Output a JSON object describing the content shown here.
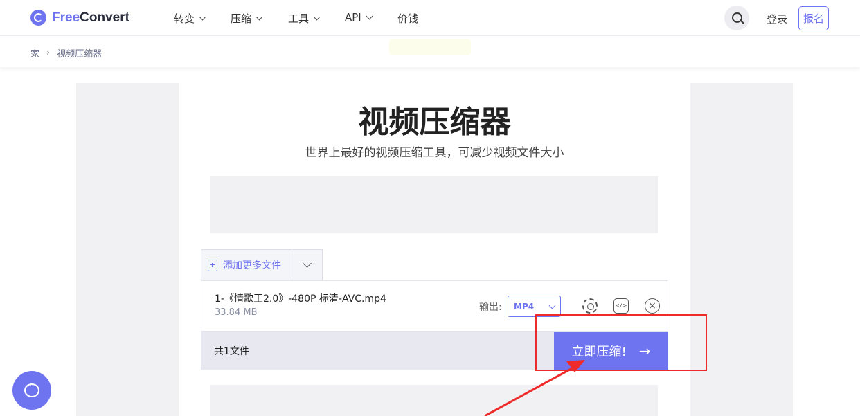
{
  "header": {
    "logo_part1": "Free",
    "logo_part2": "Convert",
    "nav": [
      {
        "label": "转变",
        "has_menu": true
      },
      {
        "label": "压缩",
        "has_menu": true
      },
      {
        "label": "工具",
        "has_menu": true
      },
      {
        "label": "API",
        "has_menu": true
      },
      {
        "label": "价钱",
        "has_menu": false
      }
    ],
    "search_icon": "search-icon",
    "login_label": "登录",
    "signup_label": "报名"
  },
  "breadcrumb": {
    "home": "家",
    "current": "视频压缩器"
  },
  "main": {
    "title": "视频压缩器",
    "subtitle": "世界上最好的视频压缩工具，可减少视频文件大小"
  },
  "uploader": {
    "add_more_label": "添加更多文件",
    "file": {
      "name": "1-《情歌王2.0》-480P 标清-AVC.mp4",
      "size": "33.84 MB",
      "output_label": "输出:",
      "output_format": "MP4"
    },
    "file_count": "共1文件",
    "compress_label": "立即压缩!",
    "compress_arrow": "→"
  },
  "colors": {
    "accent": "#6e74f0",
    "annotation": "#ee2a2a"
  }
}
